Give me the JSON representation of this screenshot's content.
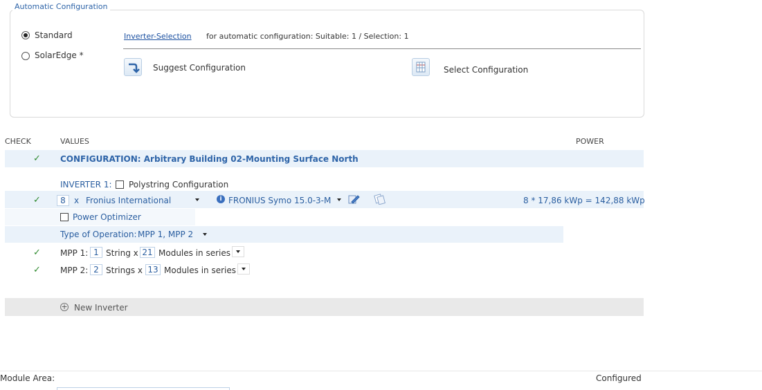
{
  "auto_config": {
    "legend": "Automatic Configuration",
    "radio_standard": "Standard",
    "radio_solaredge": "SolarEdge *",
    "inverter_selection_link": "Inverter-Selection",
    "inverter_selection_text": "for automatic configuration: Suitable: 1 / Selection: 1",
    "suggest_button": "Suggest Configuration",
    "select_button": "Select Configuration"
  },
  "table": {
    "col_check": "CHECK",
    "col_values": "VALUES",
    "col_power": "POWER",
    "configuration_title": "CONFIGURATION: Arbitrary Building 02-Mounting Surface North",
    "inverter_label": "INVERTER 1:",
    "polystring_label": "Polystring Configuration",
    "inverter_count": "8",
    "x_label": "x",
    "manufacturer": "Fronius International",
    "model": "FRONIUS Symo 15.0-3-M",
    "power_value": "8 * 17,86 kWp = 142,88 kWp",
    "power_optimizer_label": "Power Optimizer",
    "type_operation_label": "Type of Operation:",
    "type_operation_value": "MPP 1, MPP 2",
    "mpp1_label": "MPP 1:",
    "mpp1_strings": "1",
    "mpp1_string_text": "String x",
    "mpp1_modules": "21",
    "mpp1_modules_text": "Modules in series",
    "mpp2_label": "MPP 2:",
    "mpp2_strings": "2",
    "mpp2_string_text": "Strings x",
    "mpp2_modules": "13",
    "mpp2_modules_text": "Modules in series",
    "new_inverter": "New Inverter"
  },
  "footer": {
    "module_area_label": "Module Area:",
    "status": "Configured"
  },
  "colors": {
    "accent": "#2e64a8",
    "check": "#2f8a2f",
    "row_highlight": "#eaf2fa"
  }
}
